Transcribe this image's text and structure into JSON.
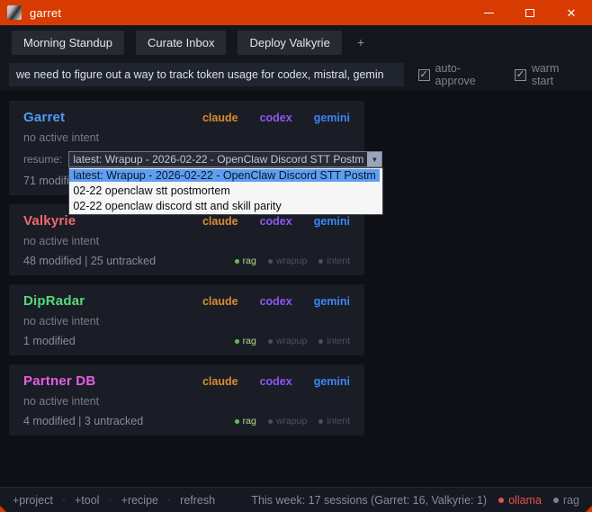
{
  "window": {
    "title": "garret"
  },
  "colors": {
    "titlebar": "#d83b01",
    "badge_active": "#b5dd8d",
    "selection": "#5e9ef2"
  },
  "link_colors": {
    "claude": "#db8b2f",
    "codex": "#8e55ef",
    "gemini": "#3d85f4"
  },
  "tabs": {
    "items": [
      "Morning Standup",
      "Curate Inbox",
      "Deploy Valkyrie"
    ],
    "add_label": "+"
  },
  "composer": {
    "input_value": "we need to figure out a way to track token usage for codex, mistral, gemin",
    "auto_approve_label": "auto-approve",
    "warm_start_label": "warm start"
  },
  "projects": [
    {
      "name": "Garret",
      "color": "#4d9bf0",
      "links": [
        "claude",
        "codex",
        "gemini"
      ],
      "intent": "no active intent",
      "stats": "71 modified",
      "resume_label": "resume:",
      "resume_selected": "latest: Wrapup - 2026-02-22 - OpenClaw Discord STT Postm",
      "resume_options": [
        "latest: Wrapup - 2026-02-22 - OpenClaw Discord STT Postm",
        "02-22 openclaw stt postmortem",
        "02-22 openclaw discord stt and skill parity"
      ],
      "badges": [
        {
          "label": "rag",
          "active": true
        },
        {
          "label": "wrapup",
          "active": false
        },
        {
          "label": "intent",
          "active": false
        }
      ]
    },
    {
      "name": "Valkyrie",
      "color": "#ef6a6a",
      "links": [
        "claude",
        "codex",
        "gemini"
      ],
      "intent": "no active intent",
      "stats": "48 modified | 25 untracked",
      "badges": [
        {
          "label": "rag",
          "active": true
        },
        {
          "label": "wrapup",
          "active": false
        },
        {
          "label": "intent",
          "active": false
        }
      ]
    },
    {
      "name": "DipRadar",
      "color": "#55d97e",
      "links": [
        "claude",
        "codex",
        "gemini"
      ],
      "intent": "no active intent",
      "stats": "1 modified",
      "badges": [
        {
          "label": "rag",
          "active": true
        },
        {
          "label": "wrapup",
          "active": false
        },
        {
          "label": "intent",
          "active": false
        }
      ]
    },
    {
      "name": "Partner DB",
      "color": "#e55fe0",
      "links": [
        "claude",
        "codex",
        "gemini"
      ],
      "intent": "no active intent",
      "stats": "4 modified | 3 untracked",
      "badges": [
        {
          "label": "rag",
          "active": true
        },
        {
          "label": "wrapup",
          "active": false
        },
        {
          "label": "intent",
          "active": false
        }
      ]
    }
  ],
  "statusbar": {
    "actions": [
      "+project",
      "+tool",
      "+recipe",
      "refresh"
    ],
    "summary": "This week: 17 sessions (Garret: 16, Valkyrie: 1)",
    "indicators": [
      {
        "label": "ollama",
        "color": "#e0524c"
      },
      {
        "label": "rag",
        "color": "#7b8290"
      }
    ]
  }
}
